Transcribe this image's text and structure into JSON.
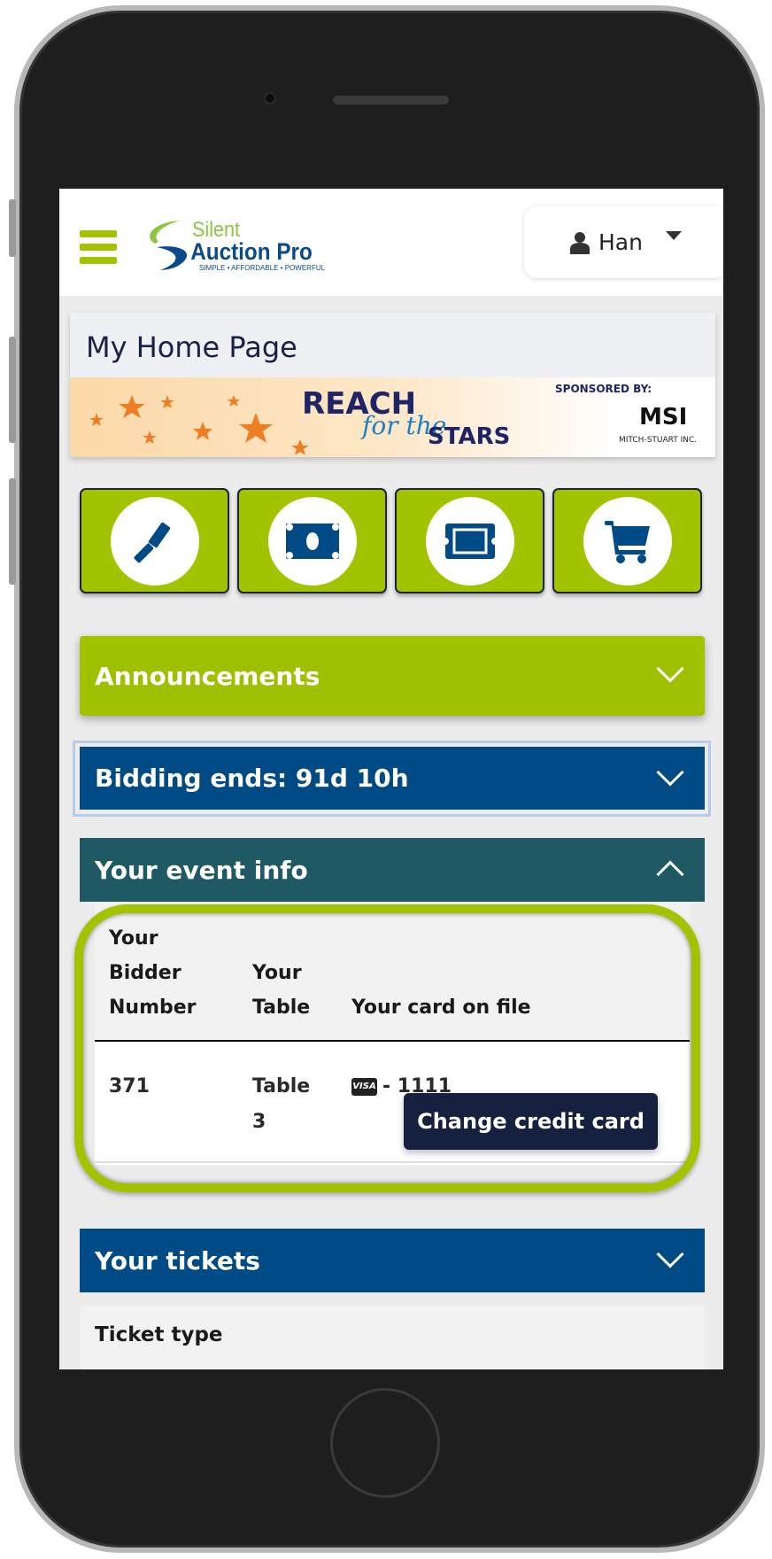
{
  "header": {
    "logo_text": "Silent Auction Pro",
    "logo_tagline": "SIMPLE • AFFORDABLE • POWERFUL",
    "user_name": "Han"
  },
  "page": {
    "title": "My Home Page"
  },
  "banner": {
    "headline": "REACH",
    "script": "for the",
    "tail": "STARS",
    "sponsor_label": "SPONSORED BY:",
    "sponsor_logo": "MSI",
    "sponsor_name": "MITCH-STUART INC."
  },
  "tiles": [
    {
      "icon": "gavel-icon"
    },
    {
      "icon": "money-icon"
    },
    {
      "icon": "ticket-icon"
    },
    {
      "icon": "cart-icon"
    }
  ],
  "sections": {
    "announcements": "Announcements",
    "bidding": "Bidding ends:  91d 10h",
    "event_info": "Your event info",
    "tickets": "Your tickets"
  },
  "event_table": {
    "headers": [
      "Your",
      "Bidder",
      "Number",
      "Your",
      "Table",
      "Your card on file"
    ],
    "bidder_number": "371",
    "table_line1": "Table",
    "table_line2": "3",
    "card_brand": "VISA",
    "card_last4": "- 1111",
    "change_card_label": "Change credit card"
  },
  "tickets_table": {
    "header": "Ticket type"
  },
  "colors": {
    "green": "#a2c400",
    "blue": "#004a85",
    "teal": "#1f5a64",
    "dark": "#16213f"
  }
}
